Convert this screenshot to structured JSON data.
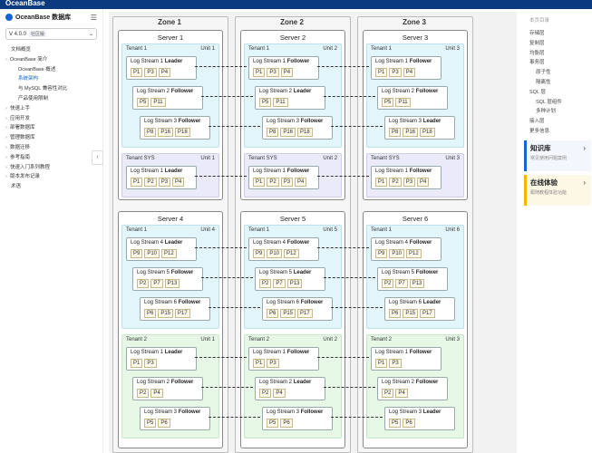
{
  "topbar": {
    "logo": "OceanBase"
  },
  "sidebar": {
    "brand": "OceanBase 数据库",
    "version": "V 4.0.0",
    "version_tag": "社区版",
    "nav": [
      {
        "label": "文档概览",
        "level": 0,
        "active": false,
        "caret": false
      },
      {
        "label": "OceanBase 简介",
        "level": 0,
        "active": false,
        "caret": true
      },
      {
        "label": "OceanBase 概述",
        "level": 1,
        "active": false,
        "caret": false
      },
      {
        "label": "系统架构",
        "level": 1,
        "active": true,
        "caret": false
      },
      {
        "label": "与 MySQL 兼容性对比",
        "level": 1,
        "active": false,
        "caret": false
      },
      {
        "label": "产品使用限制",
        "level": 1,
        "active": false,
        "caret": false
      },
      {
        "label": "快速上手",
        "level": 0,
        "active": false,
        "caret": true
      },
      {
        "label": "应用开发",
        "level": 0,
        "active": false,
        "caret": true
      },
      {
        "label": "部署数据库",
        "level": 0,
        "active": false,
        "caret": true
      },
      {
        "label": "管理数据库",
        "level": 0,
        "active": false,
        "caret": true
      },
      {
        "label": "数据迁移",
        "level": 0,
        "active": false,
        "caret": true
      },
      {
        "label": "参考指南",
        "level": 0,
        "active": false,
        "caret": true
      },
      {
        "label": "快速入门系列教程",
        "level": 0,
        "active": false,
        "caret": true
      },
      {
        "label": "版本发布记录",
        "level": 0,
        "active": false,
        "caret": true
      },
      {
        "label": "术语",
        "level": 0,
        "active": false,
        "caret": false
      }
    ]
  },
  "diagram": {
    "zones": [
      "Zone 1",
      "Zone 2",
      "Zone 3"
    ],
    "servers": [
      {
        "title": "Server 1",
        "zone": 0,
        "row": 0,
        "tenants": [
          {
            "name": "Tenant 1",
            "unit": "Unit 1",
            "color": "blue",
            "streams": [
              {
                "name": "Log Stream 1",
                "role": "Leader",
                "parts": [
                  "P1",
                  "P3",
                  "P4"
                ]
              },
              {
                "name": "Log Stream 2",
                "role": "Follower",
                "parts": [
                  "P5",
                  "P11"
                ]
              },
              {
                "name": "Log Stream 3",
                "role": "Follower",
                "parts": [
                  "P8",
                  "P16",
                  "P18"
                ]
              }
            ]
          },
          {
            "name": "Tenant SYS",
            "unit": "Unit 1",
            "color": "purple",
            "streams": [
              {
                "name": "Log Stream 1",
                "role": "Leader",
                "parts": [
                  "P1",
                  "P2",
                  "P3",
                  "P4"
                ]
              }
            ]
          }
        ]
      },
      {
        "title": "Server 2",
        "zone": 1,
        "row": 0,
        "tenants": [
          {
            "name": "Tenant 1",
            "unit": "Unit 2",
            "color": "blue",
            "streams": [
              {
                "name": "Log Stream 1",
                "role": "Follower",
                "parts": [
                  "P1",
                  "P3",
                  "P4"
                ]
              },
              {
                "name": "Log Stream 2",
                "role": "Leader",
                "parts": [
                  "P5",
                  "P11"
                ]
              },
              {
                "name": "Log Stream 3",
                "role": "Follower",
                "parts": [
                  "P8",
                  "P16",
                  "P18"
                ]
              }
            ]
          },
          {
            "name": "Tenant SYS",
            "unit": "Unit 2",
            "color": "purple",
            "streams": [
              {
                "name": "Log Stream 1",
                "role": "Follower",
                "parts": [
                  "P1",
                  "P2",
                  "P3",
                  "P4"
                ]
              }
            ]
          }
        ]
      },
      {
        "title": "Server 3",
        "zone": 2,
        "row": 0,
        "tenants": [
          {
            "name": "Tenant 1",
            "unit": "Unit 3",
            "color": "blue",
            "streams": [
              {
                "name": "Log Stream 1",
                "role": "Follower",
                "parts": [
                  "P1",
                  "P3",
                  "P4"
                ]
              },
              {
                "name": "Log Stream 2",
                "role": "Follower",
                "parts": [
                  "P5",
                  "P11"
                ]
              },
              {
                "name": "Log Stream 3",
                "role": "Leader",
                "parts": [
                  "P8",
                  "P16",
                  "P18"
                ]
              }
            ]
          },
          {
            "name": "Tenant SYS",
            "unit": "Unit 3",
            "color": "purple",
            "streams": [
              {
                "name": "Log Stream 1",
                "role": "Follower",
                "parts": [
                  "P1",
                  "P2",
                  "P3",
                  "P4"
                ]
              }
            ]
          }
        ]
      },
      {
        "title": "Server 4",
        "zone": 0,
        "row": 1,
        "tenants": [
          {
            "name": "Tenant 1",
            "unit": "Unit 4",
            "color": "blue",
            "streams": [
              {
                "name": "Log Stream 4",
                "role": "Leader",
                "parts": [
                  "P9",
                  "P10",
                  "P12"
                ]
              },
              {
                "name": "Log Stream 5",
                "role": "Follower",
                "parts": [
                  "P2",
                  "P7",
                  "P13"
                ]
              },
              {
                "name": "Log Stream 6",
                "role": "Follower",
                "parts": [
                  "P6",
                  "P15",
                  "P17"
                ]
              }
            ]
          },
          {
            "name": "Tenant 2",
            "unit": "Unit 1",
            "color": "green",
            "streams": [
              {
                "name": "Log Stream 1",
                "role": "Leader",
                "parts": [
                  "P1",
                  "P3"
                ]
              },
              {
                "name": "Log Stream 2",
                "role": "Follower",
                "parts": [
                  "P2",
                  "P4"
                ]
              },
              {
                "name": "Log Stream 3",
                "role": "Follower",
                "parts": [
                  "P5",
                  "P6"
                ]
              }
            ]
          }
        ]
      },
      {
        "title": "Server 5",
        "zone": 1,
        "row": 1,
        "tenants": [
          {
            "name": "Tenant 1",
            "unit": "Unit 5",
            "color": "blue",
            "streams": [
              {
                "name": "Log Stream 4",
                "role": "Follower",
                "parts": [
                  "P9",
                  "P10",
                  "P12"
                ]
              },
              {
                "name": "Log Stream 5",
                "role": "Leader",
                "parts": [
                  "P2",
                  "P7",
                  "P13"
                ]
              },
              {
                "name": "Log Stream 6",
                "role": "Follower",
                "parts": [
                  "P6",
                  "P15",
                  "P17"
                ]
              }
            ]
          },
          {
            "name": "Tenant 2",
            "unit": "Unit 2",
            "color": "green",
            "streams": [
              {
                "name": "Log Stream 1",
                "role": "Follower",
                "parts": [
                  "P1",
                  "P3"
                ]
              },
              {
                "name": "Log Stream 2",
                "role": "Leader",
                "parts": [
                  "P2",
                  "P4"
                ]
              },
              {
                "name": "Log Stream 3",
                "role": "Follower",
                "parts": [
                  "P5",
                  "P6"
                ]
              }
            ]
          }
        ]
      },
      {
        "title": "Server 6",
        "zone": 2,
        "row": 1,
        "tenants": [
          {
            "name": "Tenant 1",
            "unit": "Unit 6",
            "color": "blue",
            "streams": [
              {
                "name": "Log Stream 4",
                "role": "Follower",
                "parts": [
                  "P9",
                  "P10",
                  "P12"
                ]
              },
              {
                "name": "Log Stream 5",
                "role": "Follower",
                "parts": [
                  "P2",
                  "P7",
                  "P13"
                ]
              },
              {
                "name": "Log Stream 6",
                "role": "Leader",
                "parts": [
                  "P6",
                  "P15",
                  "P17"
                ]
              }
            ]
          },
          {
            "name": "Tenant 2",
            "unit": "Unit 3",
            "color": "green",
            "streams": [
              {
                "name": "Log Stream 1",
                "role": "Follower",
                "parts": [
                  "P1",
                  "P3"
                ]
              },
              {
                "name": "Log Stream 2",
                "role": "Follower",
                "parts": [
                  "P2",
                  "P4"
                ]
              },
              {
                "name": "Log Stream 3",
                "role": "Leader",
                "parts": [
                  "P5",
                  "P6"
                ]
              }
            ]
          }
        ]
      }
    ]
  },
  "toc": {
    "heading": "本页目录",
    "items": [
      {
        "label": "存储层",
        "level": 0
      },
      {
        "label": "复制层",
        "level": 0
      },
      {
        "label": "均衡层",
        "level": 0
      },
      {
        "label": "事务层",
        "level": 0
      },
      {
        "label": "原子性",
        "level": 1
      },
      {
        "label": "隔离性",
        "level": 1
      },
      {
        "label": "SQL 层",
        "level": 0
      },
      {
        "label": "SQL 层组件",
        "level": 1
      },
      {
        "label": "多种计划",
        "level": 1
      },
      {
        "label": "接入层",
        "level": 0
      },
      {
        "label": "更多信息",
        "level": 0
      }
    ]
  },
  "cards": [
    {
      "title": "知识库",
      "subtitle": "常见使用问题案例",
      "color": "blue"
    },
    {
      "title": "在线体验",
      "subtitle": "跟随教程体验功能",
      "color": "yellow"
    }
  ]
}
